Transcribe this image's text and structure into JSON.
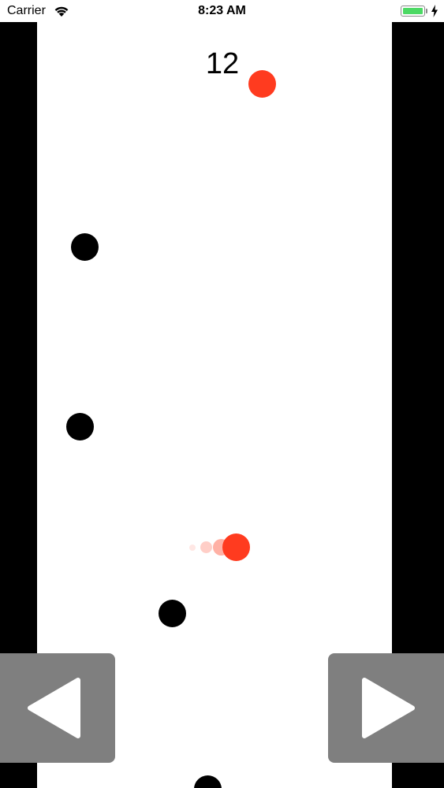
{
  "status_bar": {
    "carrier": "Carrier",
    "time": "8:23 AM",
    "battery_level": 1.0,
    "battery_color": "#4cd964",
    "icons": [
      "wifi-icon",
      "battery-icon",
      "charging-bolt-icon"
    ]
  },
  "game": {
    "score": "12",
    "player_color": "#ff3b1f",
    "obstacle_color": "#000000",
    "wall_color": "#000000"
  },
  "controls": {
    "left_icon": "left-arrow-icon",
    "right_icon": "right-arrow-icon",
    "button_color": "#7f7f7f"
  }
}
